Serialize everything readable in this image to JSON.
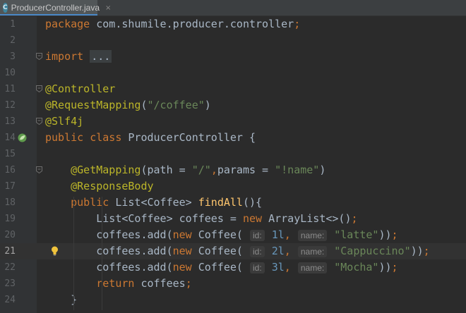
{
  "tab": {
    "title": "ProducerController.java",
    "icon": "java-class-icon",
    "close": "×"
  },
  "lines": [
    {
      "num": "1",
      "tokens": [
        {
          "t": "kw",
          "v": "package"
        },
        {
          "t": "id",
          "v": " com.shumile.producer.controller"
        },
        {
          "t": "kw",
          "v": ";"
        }
      ]
    },
    {
      "num": "2",
      "tokens": []
    },
    {
      "num": "3",
      "fold": true,
      "tokens": [
        {
          "t": "kw",
          "v": "import"
        },
        {
          "t": "id",
          "v": " "
        },
        {
          "t": "dots",
          "v": "..."
        }
      ]
    },
    {
      "num": "10",
      "tokens": []
    },
    {
      "num": "11",
      "fold": true,
      "tokens": [
        {
          "t": "ann",
          "v": "@Controller"
        }
      ]
    },
    {
      "num": "12",
      "tokens": [
        {
          "t": "ann",
          "v": "@RequestMapping"
        },
        {
          "t": "id",
          "v": "("
        },
        {
          "t": "str",
          "v": "\"/coffee\""
        },
        {
          "t": "id",
          "v": ")"
        }
      ]
    },
    {
      "num": "13",
      "fold": true,
      "tokens": [
        {
          "t": "ann",
          "v": "@Slf4j"
        }
      ]
    },
    {
      "num": "14",
      "bean": true,
      "tokens": [
        {
          "t": "kw",
          "v": "public class "
        },
        {
          "t": "id",
          "v": "ProducerController {"
        }
      ]
    },
    {
      "num": "15",
      "tokens": []
    },
    {
      "num": "16",
      "fold": true,
      "tokens": [
        {
          "t": "id",
          "v": "    "
        },
        {
          "t": "ann",
          "v": "@GetMapping"
        },
        {
          "t": "id",
          "v": "(path = "
        },
        {
          "t": "str",
          "v": "\"/\""
        },
        {
          "t": "kw",
          "v": ","
        },
        {
          "t": "id",
          "v": "params = "
        },
        {
          "t": "str",
          "v": "\"!name\""
        },
        {
          "t": "id",
          "v": ")"
        }
      ]
    },
    {
      "num": "17",
      "tokens": [
        {
          "t": "id",
          "v": "    "
        },
        {
          "t": "ann",
          "v": "@ResponseBody"
        }
      ]
    },
    {
      "num": "18",
      "tokens": [
        {
          "t": "id",
          "v": "    "
        },
        {
          "t": "kw",
          "v": "public "
        },
        {
          "t": "id",
          "v": "List<Coffee> "
        },
        {
          "t": "fn",
          "v": "findAll"
        },
        {
          "t": "id",
          "v": "(){"
        }
      ]
    },
    {
      "num": "19",
      "tokens": [
        {
          "t": "id",
          "v": "        List<Coffee> coffees = "
        },
        {
          "t": "kw",
          "v": "new "
        },
        {
          "t": "id",
          "v": "ArrayList<>()"
        },
        {
          "t": "kw",
          "v": ";"
        }
      ]
    },
    {
      "num": "20",
      "tokens": [
        {
          "t": "id",
          "v": "        coffees.add("
        },
        {
          "t": "kw",
          "v": "new "
        },
        {
          "t": "id",
          "v": "Coffee( "
        },
        {
          "t": "hint",
          "v": "id:"
        },
        {
          "t": "num",
          "v": " 1l"
        },
        {
          "t": "kw",
          "v": ", "
        },
        {
          "t": "hint",
          "v": "name:"
        },
        {
          "t": "str",
          "v": " \"latte\""
        },
        {
          "t": "id",
          "v": "))"
        },
        {
          "t": "kw",
          "v": ";"
        }
      ]
    },
    {
      "num": "21",
      "current": true,
      "bulb": true,
      "tokens": [
        {
          "t": "id",
          "v": "        coffees.add("
        },
        {
          "t": "kw",
          "v": "new "
        },
        {
          "t": "id",
          "v": "Coffee( "
        },
        {
          "t": "hint",
          "v": "id:"
        },
        {
          "t": "num",
          "v": " 2l"
        },
        {
          "t": "kw",
          "v": ", "
        },
        {
          "t": "hint",
          "v": "name:"
        },
        {
          "t": "str",
          "v": " \"Cappuccino\""
        },
        {
          "t": "id",
          "v": "))"
        },
        {
          "t": "kw",
          "v": ";"
        }
      ]
    },
    {
      "num": "22",
      "tokens": [
        {
          "t": "id",
          "v": "        coffees.add("
        },
        {
          "t": "kw",
          "v": "new "
        },
        {
          "t": "id",
          "v": "Coffee( "
        },
        {
          "t": "hint",
          "v": "id:"
        },
        {
          "t": "num",
          "v": " 3l"
        },
        {
          "t": "kw",
          "v": ", "
        },
        {
          "t": "hint",
          "v": "name:"
        },
        {
          "t": "str",
          "v": " \"Mocha\""
        },
        {
          "t": "id",
          "v": "))"
        },
        {
          "t": "kw",
          "v": ";"
        }
      ]
    },
    {
      "num": "23",
      "tokens": [
        {
          "t": "id",
          "v": "        "
        },
        {
          "t": "kw",
          "v": "return "
        },
        {
          "t": "id",
          "v": "coffees"
        },
        {
          "t": "kw",
          "v": ";"
        }
      ]
    },
    {
      "num": "24",
      "tokens": [
        {
          "t": "id",
          "v": "    }"
        }
      ]
    }
  ],
  "colors": {
    "background": "#2b2b2b",
    "gutter": "#313335",
    "keyword": "#cc7832",
    "annotation": "#bbb529",
    "string": "#6a8759",
    "number": "#6897bb",
    "method": "#ffc66d"
  }
}
